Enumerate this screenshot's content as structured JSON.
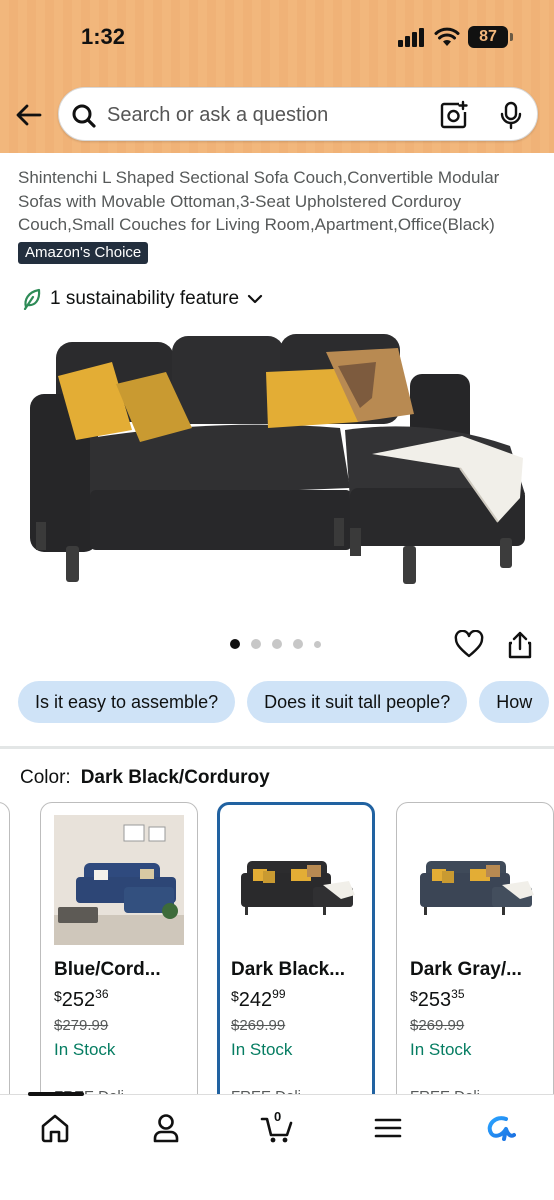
{
  "status_bar": {
    "time": "1:32",
    "battery": "87"
  },
  "search": {
    "placeholder": "Search or ask a question"
  },
  "product": {
    "title": "Shintenchi L Shaped Sectional Sofa Couch,Convertible Modular Sofas with Movable Ottoman,3-Seat Upholstered Corduroy Couch,Small Couches for Living Room,Apartment,Office(Black)",
    "badge": "Amazon's Choice",
    "sustainability": "1 sustainability feature"
  },
  "gallery": {
    "image_count": 5,
    "active_index": 0
  },
  "questions": [
    "Is it easy to assemble?",
    "Does it suit tall people?",
    "How"
  ],
  "color": {
    "label": "Color:",
    "selected": "Dark Black/Corduroy"
  },
  "swatches": [
    {
      "name": "Blue/Cord...",
      "price_whole": "252",
      "price_frac": "36",
      "currency": "$",
      "list_price": "$279.99",
      "stock": "In Stock",
      "free": "FREE Deli",
      "color": "#2f4a7e"
    },
    {
      "name": "Dark Black...",
      "price_whole": "242",
      "price_frac": "99",
      "currency": "$",
      "list_price": "$269.99",
      "stock": "In Stock",
      "free": "FREE Deli",
      "color": "#2c2c2e"
    },
    {
      "name": "Dark Gray/...",
      "price_whole": "253",
      "price_frac": "35",
      "currency": "$",
      "list_price": "$269.99",
      "stock": "In Stock",
      "free": "FREE Deli",
      "color": "#3f4a59"
    }
  ],
  "bottom_nav": {
    "cart_count": "0"
  },
  "colors": {
    "header": "#f2b77c",
    "chip": "#cfe3f7",
    "stock_green": "#067d62",
    "selected_border": "#2162a1",
    "badge_bg": "#232f3e"
  }
}
